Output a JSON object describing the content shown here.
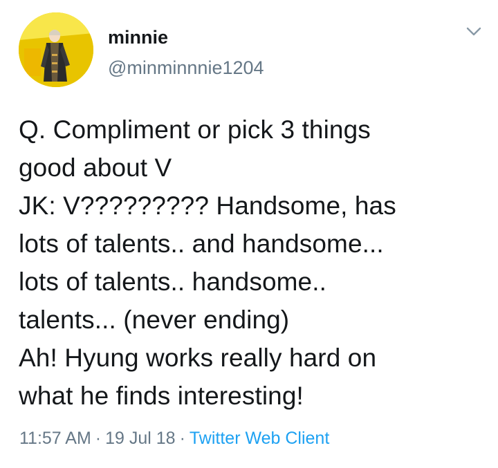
{
  "tweet": {
    "author": {
      "display_name": "minnie",
      "handle": "@minminnnie1204",
      "avatar": "profile-photo"
    },
    "menu_icon": "chevron-down-icon",
    "text": "Q. Compliment or pick 3 things\ngood about V\nJK: V????????? Handsome, has\nlots of talents.. and handsome...\nlots of talents.. handsome..\ntalents... (never ending)\nAh! Hyung works really hard on\nwhat he finds interesting!",
    "time": "11:57 AM",
    "separator_1": "·",
    "date": "19 Jul 18",
    "separator_2": "·",
    "client": "Twitter Web Client"
  },
  "colors": {
    "text": "#14171a",
    "secondary": "#657786",
    "link": "#1da1f2",
    "avatar_background": "#f2d400"
  }
}
